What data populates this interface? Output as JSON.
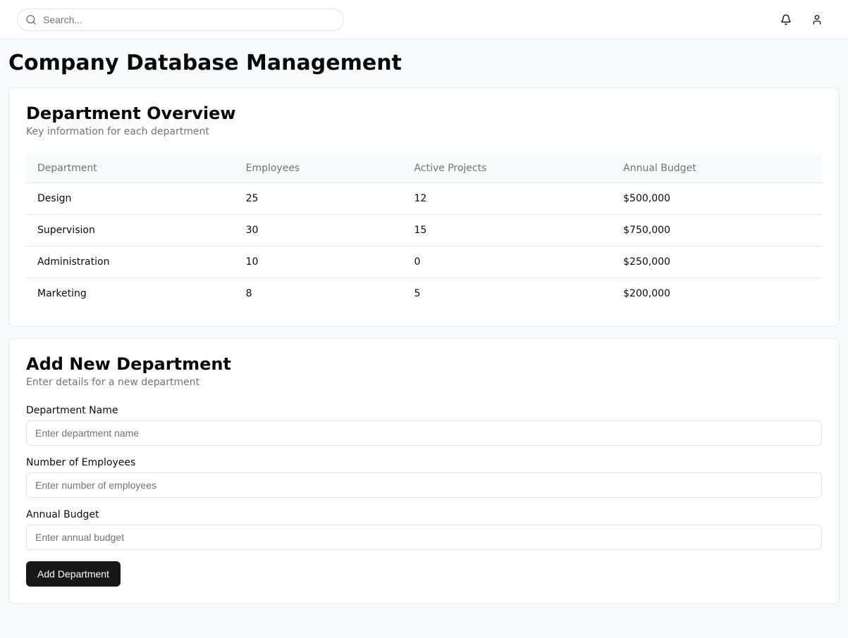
{
  "header": {
    "search_placeholder": "Search..."
  },
  "page": {
    "title": "Company Database Management"
  },
  "overview_card": {
    "title": "Department Overview",
    "description": "Key information for each department",
    "columns": [
      "Department",
      "Employees",
      "Active Projects",
      "Annual Budget"
    ],
    "rows": [
      {
        "department": "Design",
        "employees": "25",
        "projects": "12",
        "budget": "$500,000"
      },
      {
        "department": "Supervision",
        "employees": "30",
        "projects": "15",
        "budget": "$750,000"
      },
      {
        "department": "Administration",
        "employees": "10",
        "projects": "0",
        "budget": "$250,000"
      },
      {
        "department": "Marketing",
        "employees": "8",
        "projects": "5",
        "budget": "$200,000"
      }
    ]
  },
  "form_card": {
    "title": "Add New Department",
    "description": "Enter details for a new department",
    "fields": {
      "name": {
        "label": "Department Name",
        "placeholder": "Enter department name"
      },
      "employees": {
        "label": "Number of Employees",
        "placeholder": "Enter number of employees"
      },
      "budget": {
        "label": "Annual Budget",
        "placeholder": "Enter annual budget"
      }
    },
    "submit_label": "Add Department"
  }
}
